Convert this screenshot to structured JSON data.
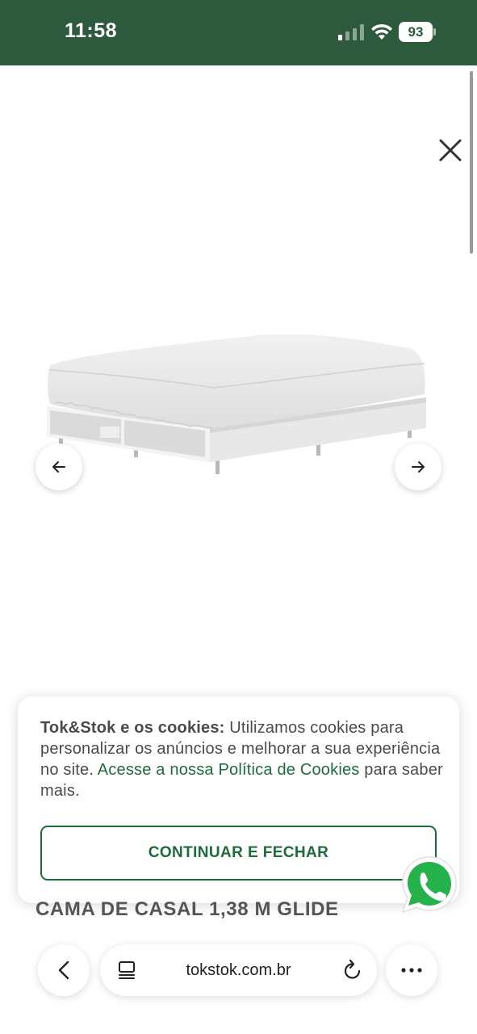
{
  "status_bar": {
    "time": "11:58",
    "battery_level": "93",
    "background_color": "#2d5a3c"
  },
  "icons": {
    "close": "close-icon",
    "prev": "arrow-left-icon",
    "next": "arrow-right-icon",
    "whatsapp": "whatsapp-icon",
    "back": "chevron-left-icon",
    "tabs": "tabs-icon",
    "reload": "reload-icon",
    "more": "more-dots-icon"
  },
  "cookie_banner": {
    "bold_text": "Tok&Stok e os cookies:",
    "text_1": " Utilizamos cookies para personalizar os anúncios e melhorar a sua experiência no site. ",
    "link_text": "Acesse a nossa Política de Cookies",
    "text_2": " para saber mais.",
    "button_label": "CONTINUAR E FECHAR",
    "accent_color": "#1d6b3b"
  },
  "product": {
    "title": "CAMA DE CASAL 1,38 M GLIDE"
  },
  "browser": {
    "url": "tokstok.com.br"
  }
}
